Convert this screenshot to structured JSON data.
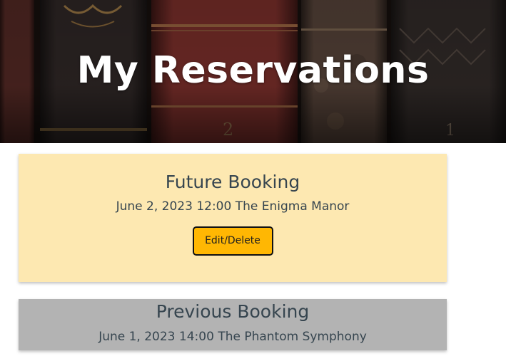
{
  "hero": {
    "title": "My Reservations",
    "spine_numerals": [
      "2",
      "1"
    ]
  },
  "future_booking": {
    "heading": "Future Booking",
    "date": "June 2, 2023",
    "time": "12:00",
    "room": "The Enigma Manor",
    "button_label": "Edit/Delete"
  },
  "previous_booking": {
    "heading": "Previous Booking",
    "date": "June 1, 2023",
    "time": "14:00",
    "room": "The Phantom Symphony"
  },
  "colors": {
    "future_card_bg": "#fde8b1",
    "past_card_bg": "#b3b3b3",
    "button_bg": "#ffb703",
    "text": "#36454f"
  }
}
